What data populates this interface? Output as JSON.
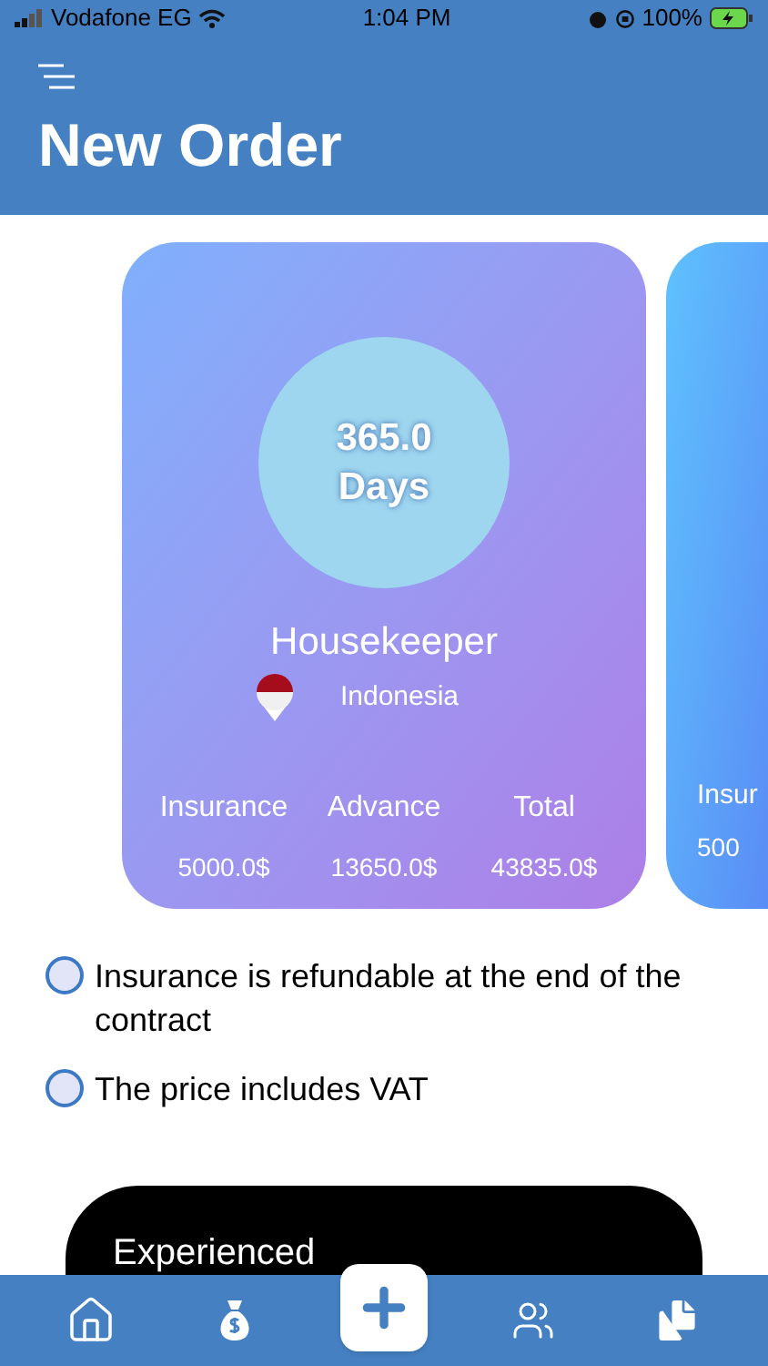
{
  "status_bar": {
    "carrier": "Vodafone EG",
    "time": "1:04 PM",
    "battery": "100%"
  },
  "header": {
    "title": "New Order"
  },
  "cards": [
    {
      "kind": "full",
      "days": "365.0",
      "days_unit": "Days",
      "job": "Housekeeper",
      "country": "Indonesia",
      "fees": [
        {
          "label": "Insurance",
          "value": "5000.0$"
        },
        {
          "label": "Advance",
          "value": "13650.0$"
        },
        {
          "label": "Total",
          "value": "43835.0$"
        }
      ]
    },
    {
      "kind": "partial",
      "fees": [
        {
          "label": "Insur",
          "value": "500"
        }
      ]
    }
  ],
  "options": [
    {
      "label": "Insurance is refundable at the end of the contract",
      "selected": false
    },
    {
      "label": "The price includes VAT",
      "selected": false
    }
  ],
  "next_card": {
    "title": "Experienced"
  },
  "bottom_nav": [
    {
      "kind": "home",
      "selected": false
    },
    {
      "kind": "money",
      "selected": false
    },
    {
      "kind": "add",
      "selected": true
    },
    {
      "kind": "users",
      "selected": false
    },
    {
      "kind": "files",
      "selected": false
    }
  ]
}
